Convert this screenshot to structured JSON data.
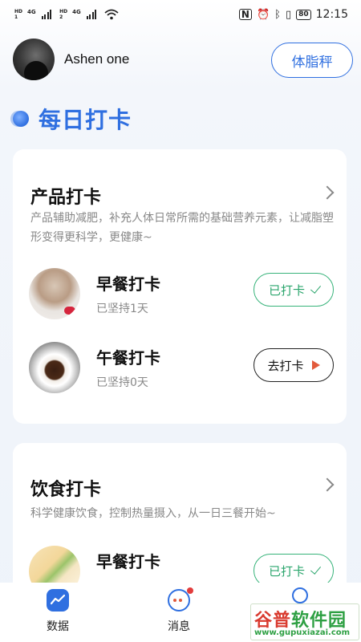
{
  "status_bar": {
    "sim1": [
      "HD",
      "1"
    ],
    "sim2": [
      "HD",
      "2"
    ],
    "network1": "4G",
    "network2": "4G",
    "battery": "80",
    "time": "12:15"
  },
  "header": {
    "user_name": "Ashen one",
    "scale_button": "体脂秤"
  },
  "section_title": "每日打卡",
  "product_card": {
    "title": "产品打卡",
    "description": "产品辅助减肥，补充人体日常所需的基础营养元素，让减脂塑形变得更科学，更健康~",
    "items": [
      {
        "name": "早餐打卡",
        "sub": "已坚持1天",
        "button": "已打卡",
        "state": "done",
        "image": "smoothie-image"
      },
      {
        "name": "午餐打卡",
        "sub": "已坚持0天",
        "button": "去打卡",
        "state": "go",
        "image": "coffee-image"
      }
    ]
  },
  "diet_card": {
    "title": "饮食打卡",
    "description": "科学健康饮食，控制热量摄入，从一日三餐开始~",
    "items": [
      {
        "name": "早餐打卡",
        "sub": "",
        "button": "已打卡",
        "state": "done",
        "image": "sandwich-image"
      }
    ]
  },
  "tabbar": {
    "tabs": [
      {
        "label": "数据",
        "icon": "data-chart-icon",
        "active": true
      },
      {
        "label": "消息",
        "icon": "message-icon",
        "badge": true
      },
      {
        "label": "",
        "icon": "profile-icon"
      }
    ]
  },
  "watermark": {
    "logo_a": "谷普",
    "logo_b": "软件园",
    "url": "www.gupuxiazai.com"
  },
  "colors": {
    "accent": "#2f6fe0",
    "done_green": "#2aa56c",
    "go_arrow": "#e25a3c"
  }
}
